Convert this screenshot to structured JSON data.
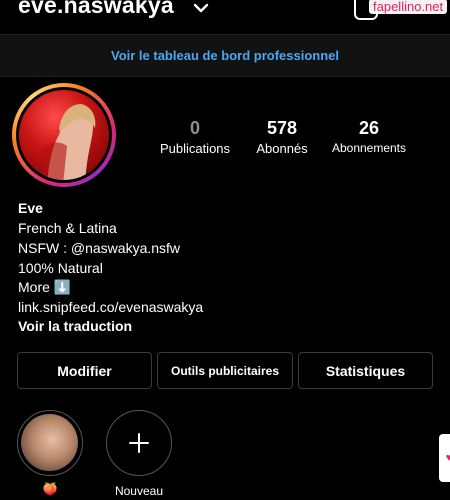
{
  "header": {
    "username": "eve.naswakya",
    "chevron_icon": "chevron-down-icon",
    "create_icon": "plus-square-icon",
    "watermark": "fapellino.net"
  },
  "dashboard_link": "Voir le tableau de bord professionnel",
  "stats": [
    {
      "value": "0",
      "label": "Publications"
    },
    {
      "value": "578",
      "label": "Abonnés"
    },
    {
      "value": "26",
      "label": "Abonnements"
    }
  ],
  "bio": {
    "name": "Eve",
    "lines": [
      "French & Latina",
      "NSFW : @naswakya.nsfw",
      "100% Natural",
      "More ⬇️"
    ],
    "link": "link.snipfeed.co/evenaswakya",
    "translate": "Voir la traduction"
  },
  "buttons": {
    "edit": "Modifier",
    "ads_tools": "Outils publicitaires",
    "insights": "Statistiques"
  },
  "highlights": [
    {
      "label": "🍑"
    },
    {
      "label": "Nouveau",
      "icon": "plus-icon"
    }
  ],
  "colors": {
    "link": "#4aa8f0",
    "ring": "#d62976",
    "watermark": "#e91e63"
  }
}
